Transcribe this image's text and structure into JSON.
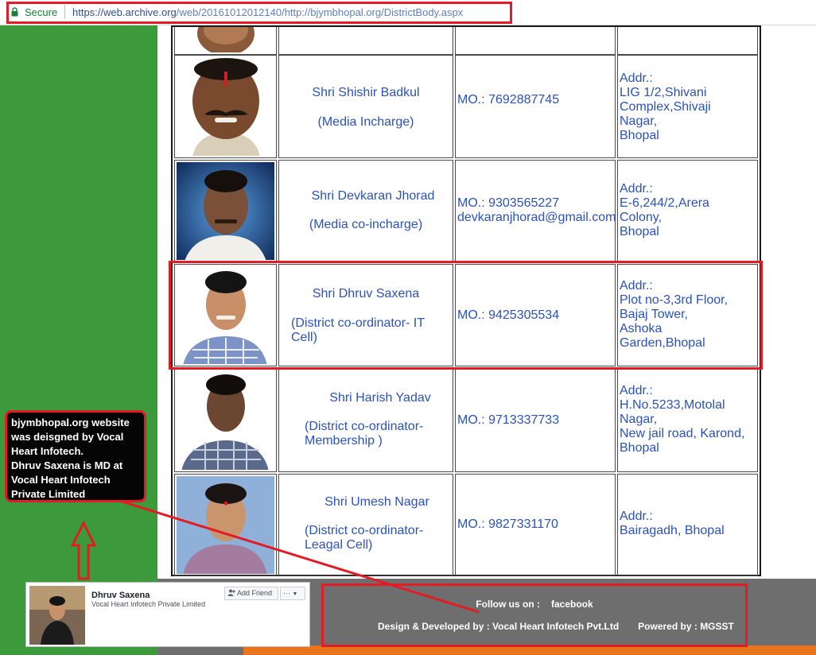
{
  "address_bar": {
    "secure_label": "Secure",
    "url_base": "https://web.archive.org",
    "url_rest": "/web/20161012012140/http://bjymbhopal.org/DistrictBody.aspx"
  },
  "members": [
    {
      "name": "Shri Shishir Badkul",
      "position": "(Media Incharge)",
      "mobile": "MO.:  7692887745",
      "email": "",
      "address": "Addr.:\n LIG 1/2,Shivani\n Complex,Shivaji\nNagar,\n  Bhopal"
    },
    {
      "name": "Shri Devkaran Jhorad",
      "position": "(Media co-incharge)",
      "mobile": "MO.:  9303565227",
      "email": "devkaranjhorad@gmail.com",
      "address": "  Addr.:\n  E-6,244/2,Arera\nColony,\n  Bhopal"
    },
    {
      "name": "Shri Dhruv Saxena",
      "position": "(District co-ordinator- IT Cell)",
      "mobile": "MO.:  9425305534",
      "email": "",
      "address": "Addr.:\n  Plot no-3,3rd Floor,\n  Bajaj Tower,\n  Ashoka\nGarden,Bhopal"
    },
    {
      "name": "Shri Harish Yadav",
      "position": "(District co-ordinator- Membership )",
      "mobile": "MO.:  9713337733",
      "email": "",
      "address": "  Addr.:\n  H.No.5233,Motolal\n Nagar,\n New jail road, Karond,\nBhopal"
    },
    {
      "name": "Shri Umesh Nagar",
      "position": "(District co-ordinator- Leagal Cell)",
      "mobile": "MO.:  9827331170",
      "email": "",
      "address": "  Addr.:\n  Bairagadh, Bhopal"
    }
  ],
  "annotation": {
    "note": "bjymbhopal.org website\nwas deisgned by Vocal\nHeart Infotech.\nDhruv Saxena is MD at\nVocal Heart Infotech\nPrivate Limited"
  },
  "facebook_card": {
    "name": "Dhruv Saxena",
    "subtitle": "Vocal Heart Infotech Private Limited",
    "add_friend_label": "Add Friend",
    "more_label": "···"
  },
  "footer": {
    "follow_label": "Follow us on   :",
    "follow_link": "facebook",
    "design_credit": "Design & Developed by : Vocal Heart Infotech Pvt.Ltd",
    "powered_credit": "Powered by :  MGSST"
  },
  "colors": {
    "highlight_red": "#e31b23",
    "sidebar_green": "#3c9a3c",
    "link_blue": "#2a52b8",
    "footer_gray": "#6e6e6e",
    "footer_orange": "#e8741c"
  }
}
